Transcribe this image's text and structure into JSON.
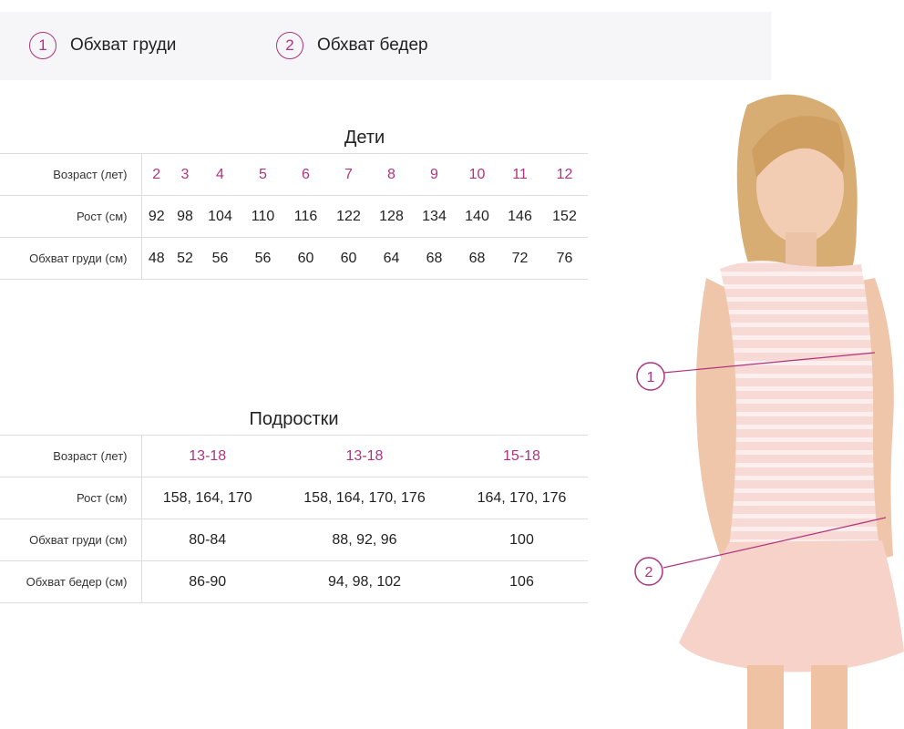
{
  "legend": [
    {
      "number": "1",
      "label": "Обхват груди"
    },
    {
      "number": "2",
      "label": "Обхват бедер"
    }
  ],
  "kids": {
    "title": "Дети",
    "row_labels": {
      "age": "Возраст (лет)",
      "height": "Рост (см)",
      "chest": "Обхват груди (см)"
    },
    "age": [
      "2",
      "3",
      "4",
      "5",
      "6",
      "7",
      "8",
      "9",
      "10",
      "11",
      "12"
    ],
    "height": [
      "92",
      "98",
      "104",
      "110",
      "116",
      "122",
      "128",
      "134",
      "140",
      "146",
      "152"
    ],
    "chest": [
      "48",
      "52",
      "56",
      "56",
      "60",
      "60",
      "64",
      "68",
      "68",
      "72",
      "76"
    ]
  },
  "teens": {
    "title": "Подростки",
    "row_labels": {
      "age": "Возраст (лет)",
      "height": "Рост (см)",
      "chest": "Обхват груди (см)",
      "hips": "Обхват бедер (см)"
    },
    "age": [
      "13-18",
      "13-18",
      "15-18"
    ],
    "height": [
      "158, 164, 170",
      "158, 164, 170, 176",
      "164, 170, 176"
    ],
    "chest": [
      "80-84",
      "88, 92, 96",
      "100"
    ],
    "hips": [
      "86-90",
      "94, 98, 102",
      "106"
    ]
  },
  "figure": {
    "markers": [
      "1",
      "2"
    ]
  },
  "colors": {
    "accent": "#b0337e",
    "legend_bg": "#f6f6f9",
    "border": "#dddddd"
  }
}
